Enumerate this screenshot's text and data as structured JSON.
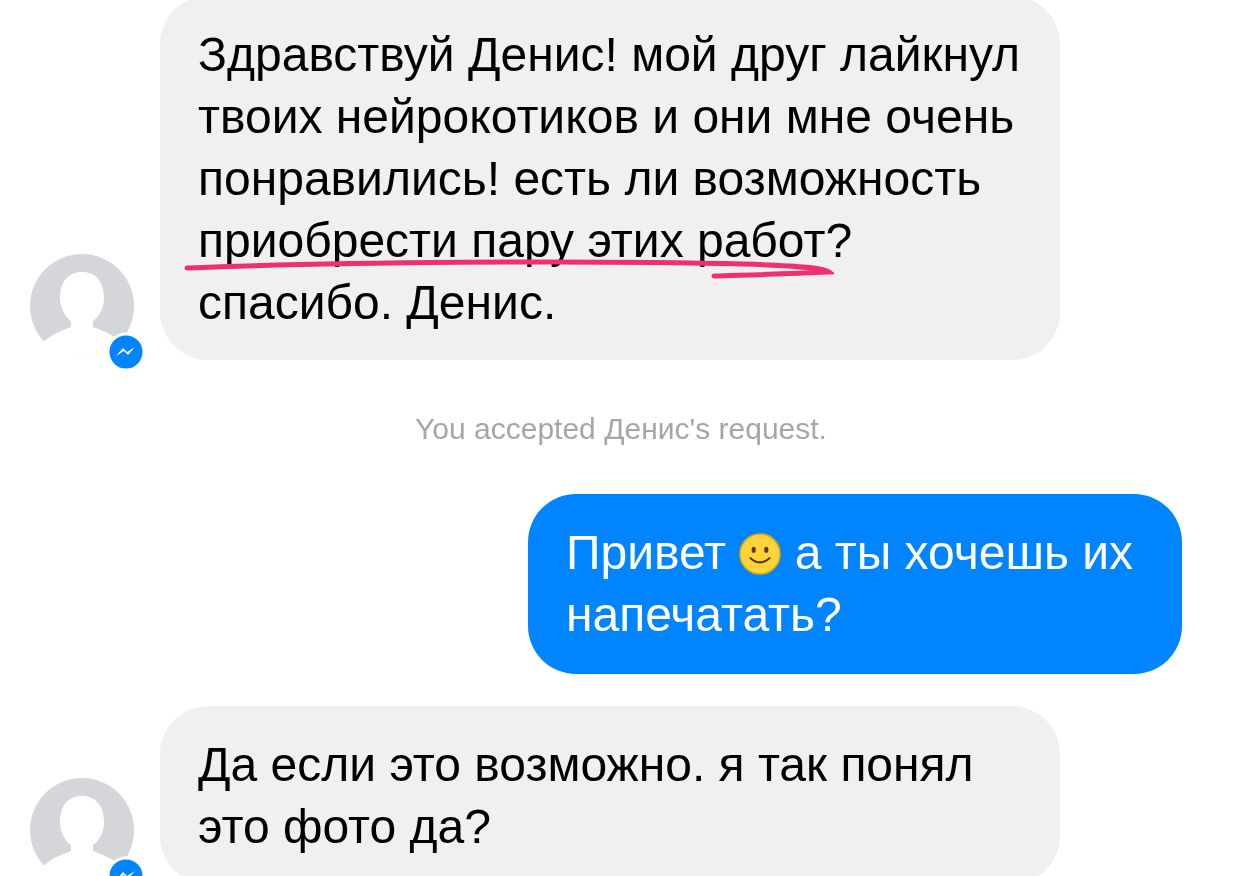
{
  "messages": [
    {
      "kind": "incoming",
      "text": "Здравствуй Денис! мой друг лайкнул твоих нейрокотиков и они мне очень понравились! есть ли возможность приобрести пару этих работ? спасибо. Денис.",
      "underlined": true
    },
    {
      "kind": "system",
      "text": "You accepted Денис's request."
    },
    {
      "kind": "outgoing",
      "parts": [
        {
          "kind": "text",
          "text": "Привет"
        },
        {
          "kind": "emoji"
        },
        {
          "kind": "text",
          "text": "а ты хочешь их"
        },
        {
          "kind": "text",
          "text": "напечатать?"
        }
      ]
    },
    {
      "kind": "incoming",
      "text": "Да если это возможно. я так понял это фото да?"
    }
  ]
}
